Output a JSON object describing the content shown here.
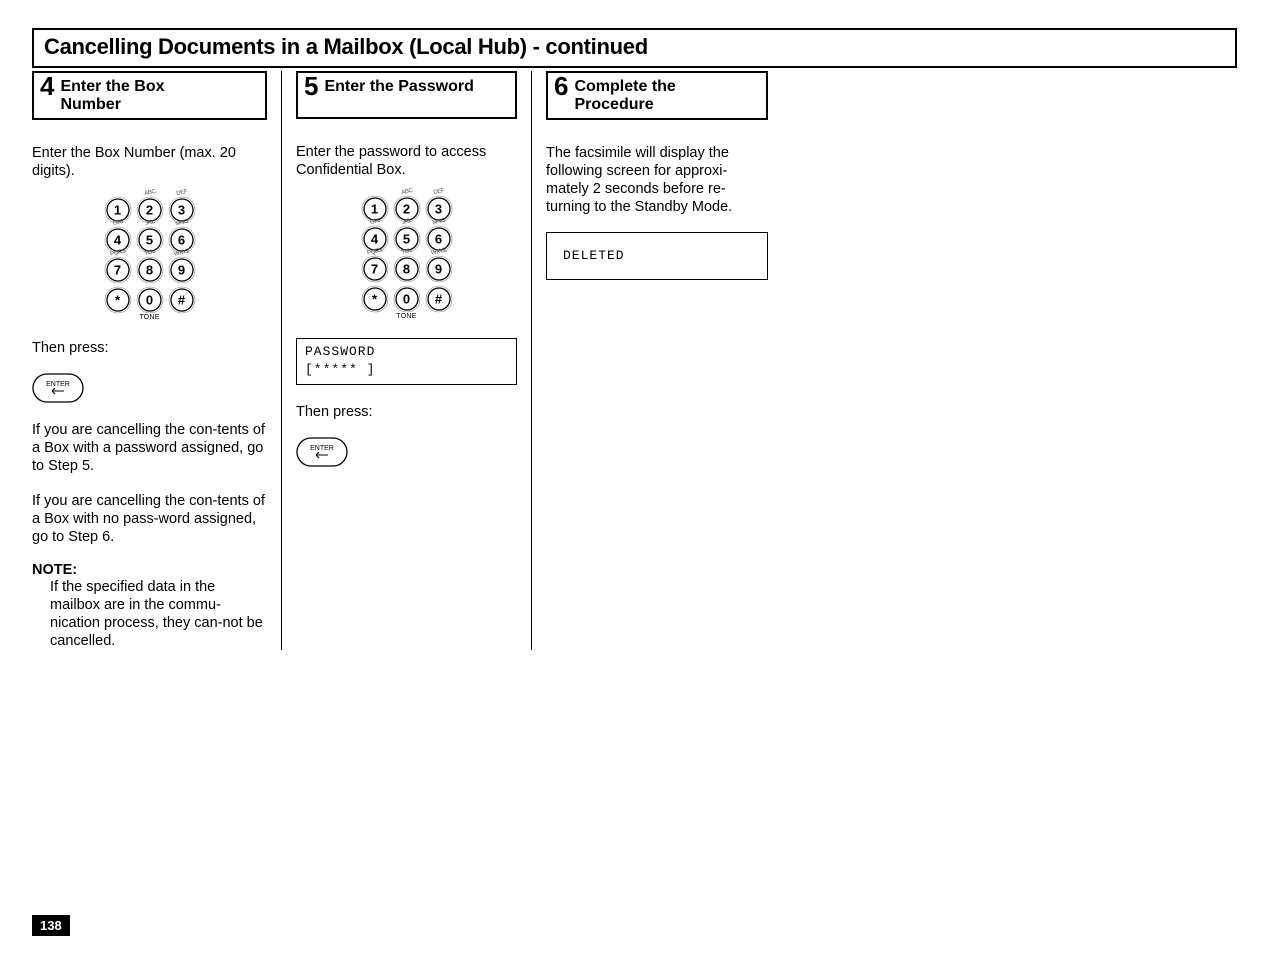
{
  "page_title": "Cancelling Documents in a Mailbox (Local Hub) - continued",
  "page_number": "138",
  "step4": {
    "num": "4",
    "title": "Enter the Box Number",
    "intro": "Enter the Box Number (max. 20 digits).",
    "then_press": "Then press:",
    "para2": "If you are cancelling the con-tents of a Box with a password assigned, go to Step 5.",
    "para3": "If you are cancelling the con-tents of a Box with no pass-word assigned, go to Step 6.",
    "note_hd": "NOTE:",
    "note_bd": "If the specified data in the mailbox are in the commu-nication process, they can-not be cancelled."
  },
  "step5": {
    "num": "5",
    "title": "Enter the Password",
    "intro": "Enter the password to access Confidential Box.",
    "lcd_line1": "PASSWORD",
    "lcd_line2": "[*****          ]",
    "then_press": "Then press:"
  },
  "step6": {
    "num": "6",
    "title": "Complete the Procedure",
    "intro": "The facsimile will display the following screen for approxi-mately 2 seconds before re-turning to the Standby Mode.",
    "lcd": "DELETED"
  },
  "keypad": {
    "r1": [
      "1",
      "2",
      "3"
    ],
    "r2": [
      "4",
      "5",
      "6"
    ],
    "r3": [
      "7",
      "8",
      "9"
    ],
    "r4": [
      "*",
      "0",
      "#"
    ],
    "tone": "TONE",
    "letters": {
      "2": "ABC",
      "3": "DEF",
      "4": "GHI",
      "5": "JKL",
      "6": "MNO",
      "7": "PQRS",
      "8": "TUV",
      "9": "WXYZ"
    }
  },
  "enter_label": "ENTER"
}
